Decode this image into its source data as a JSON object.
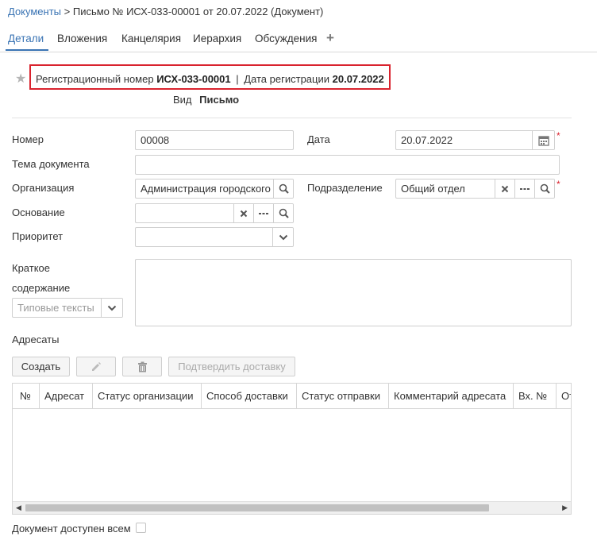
{
  "breadcrumb": {
    "root_link": "Документы",
    "separator": ">",
    "current": "Письмо № ИСХ-033-00001 от 20.07.2022 (Документ)"
  },
  "tabs": [
    {
      "label": "Детали",
      "active": true
    },
    {
      "label": "Вложения"
    },
    {
      "label": "Канцелярия"
    },
    {
      "label": "Иерархия"
    },
    {
      "label": "Обсуждения"
    }
  ],
  "header": {
    "reg_number_label": "Регистрационный номер",
    "reg_number": "ИСХ-033-00001",
    "divider": "|",
    "reg_date_label": "Дата регистрации",
    "reg_date": "20.07.2022",
    "kind_label": "Вид",
    "kind_value": "Письмо"
  },
  "form": {
    "number_label": "Номер",
    "number_value": "00008",
    "date_label": "Дата",
    "date_value": "20.07.2022",
    "required_mark": "*",
    "subject_label": "Тема документа",
    "subject_value": "",
    "org_label": "Организация",
    "org_value": "Администрация городского",
    "division_label": "Подразделение",
    "division_value": "Общий отдел",
    "basis_label": "Основание",
    "basis_value": "",
    "priority_label": "Приоритет",
    "priority_value": "",
    "summary_label_1": "Краткое",
    "summary_label_2": "содержание",
    "summary_value": "",
    "templates_placeholder": "Типовые тексты"
  },
  "addressees": {
    "label": "Адресаты",
    "create_button": "Создать",
    "confirm_button": "Подтвердить доставку",
    "columns": [
      "№",
      "Адресат",
      "Статус организации",
      "Способ доставки",
      "Статус отправки",
      "Комментарий адресата",
      "Вх. №",
      "От"
    ],
    "rows": []
  },
  "footer": {
    "public_label": "Документ доступен всем",
    "public_checked": false
  },
  "colors": {
    "accent": "#3a74b4",
    "highlight_border": "#d9232e",
    "required": "#d9232e"
  }
}
